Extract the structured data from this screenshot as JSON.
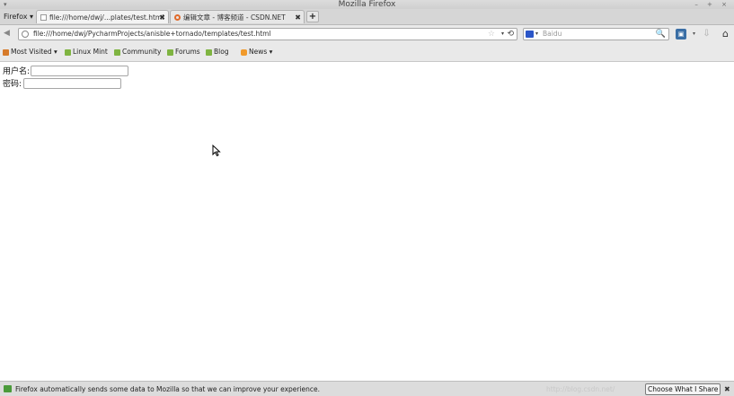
{
  "window": {
    "title": "Mozilla Firefox",
    "controls": "– + ×",
    "menu_glyph": "▾"
  },
  "app_menu": {
    "label": "Firefox ▾"
  },
  "tabs": [
    {
      "title": "file:///home/dwj/...plates/test.html",
      "close": "✖",
      "active": true
    },
    {
      "title": "编辑文章 - 博客频道 - CSDN.NET",
      "close": "✖",
      "active": false
    }
  ],
  "new_tab": "+",
  "nav": {
    "back": "◀",
    "url": "file:///home/dwj/PycharmProjects/anisble+tornado/templates/test.html",
    "star": "☆",
    "dropdown": "▾",
    "reload": "⟲",
    "search_placeholder": "Baidu",
    "search_dropdown": "▾",
    "search_button": "🔍",
    "addon_dropdown": "▾",
    "download": "⇩",
    "home": "⌂"
  },
  "bookmarks": [
    {
      "label": "Most Visited ▾",
      "icon": "most-visited-icon"
    },
    {
      "label": "Linux Mint",
      "icon": "leaf-icon"
    },
    {
      "label": "Community",
      "icon": "leaf-icon"
    },
    {
      "label": "Forums",
      "icon": "leaf-icon"
    },
    {
      "label": "Blog",
      "icon": "leaf-icon"
    },
    {
      "label": "News ▾",
      "icon": "rss-icon"
    }
  ],
  "form": {
    "username_label": "用户名:",
    "username_value": "",
    "password_label": "密码:",
    "password_value": ""
  },
  "notification": {
    "message": "Firefox automatically sends some data to Mozilla so that we can improve your experience.",
    "watermark": "http://blog.csdn.net/",
    "share_button": "Choose What I Share",
    "close": "✖"
  }
}
